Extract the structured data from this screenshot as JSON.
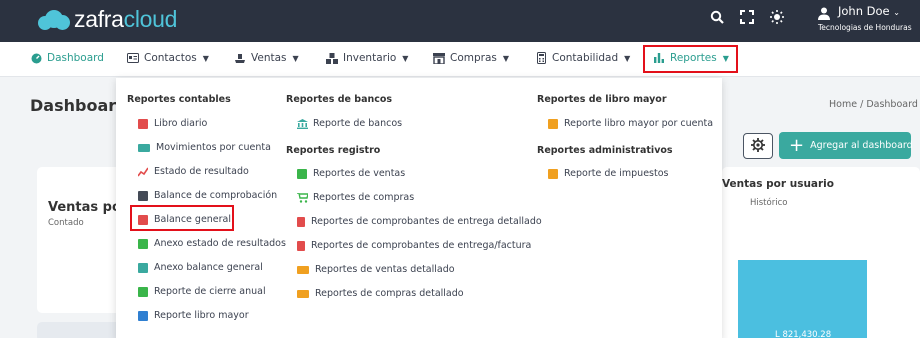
{
  "brand": {
    "name_prefix": "zafra",
    "name_suffix": "cloud"
  },
  "topbar": {
    "icons": [
      "search-icon",
      "fullscreen-icon",
      "brightness-icon"
    ],
    "user_name": "John Doe",
    "organization": "Tecnologias de Honduras"
  },
  "nav": {
    "items": [
      {
        "label": "Dashboard",
        "icon": "dashboard-icon"
      },
      {
        "label": "Contactos",
        "icon": "contact-card-icon"
      },
      {
        "label": "Ventas",
        "icon": "sales-icon"
      },
      {
        "label": "Inventario",
        "icon": "boxes-icon"
      },
      {
        "label": "Compras",
        "icon": "store-icon"
      },
      {
        "label": "Contabilidad",
        "icon": "calculator-icon"
      },
      {
        "label": "Reportes",
        "icon": "bar-chart-icon"
      }
    ]
  },
  "page": {
    "title": "Dashboard",
    "breadcrumb": [
      "Home",
      "Dashboard"
    ],
    "gear_icon": "gear-icon",
    "add_button": "Agregar al dashboard"
  },
  "cards": {
    "ventas_title": "Ventas po",
    "ventas_sub": "Contado",
    "usuario_title": "Ventas por usuario",
    "usuario_sub": "Histórico",
    "bar_value": "L 821,430.28"
  },
  "dropdown": {
    "col1": {
      "heading": "Reportes contables",
      "items": [
        {
          "label": "Libro diario",
          "color": "#e24c4c"
        },
        {
          "label": "Movimientos por cuenta",
          "color": "#3aa99f"
        },
        {
          "label": "Estado de resultado",
          "color": "#e24c4c"
        },
        {
          "label": "Balance de comprobación",
          "color": "#444b57"
        },
        {
          "label": "Balance general",
          "color": "#e24c4c"
        },
        {
          "label": "Anexo estado de resultados",
          "color": "#3ab54a"
        },
        {
          "label": "Anexo balance general",
          "color": "#3aa99f"
        },
        {
          "label": "Reporte de cierre anual",
          "color": "#3ab54a"
        },
        {
          "label": "Reporte libro mayor",
          "color": "#2f7fd1"
        }
      ]
    },
    "col2": {
      "heading": "Reportes de bancos",
      "items": [
        {
          "label": "Reporte de bancos",
          "color": "#3aa99f"
        }
      ],
      "heading2": "Reportes registro",
      "items2": [
        {
          "label": "Reportes de ventas",
          "color": "#3ab54a"
        },
        {
          "label": "Reportes de compras",
          "color": "#3ab54a"
        },
        {
          "label": "Reportes de comprobantes de entrega detallado",
          "color": "#e24c4c"
        },
        {
          "label": "Reportes de comprobantes de entrega/factura",
          "color": "#e24c4c"
        },
        {
          "label": "Reportes de ventas detallado",
          "color": "#f0a020"
        },
        {
          "label": "Reportes de compras detallado",
          "color": "#f0a020"
        }
      ]
    },
    "col3": {
      "heading": "Reportes de libro mayor",
      "items": [
        {
          "label": "Reporte libro mayor por cuenta",
          "color": "#f0a020"
        }
      ],
      "heading2": "Reportes administrativos",
      "items2": [
        {
          "label": "Reporte de impuestos",
          "color": "#f0a020"
        }
      ]
    }
  },
  "colors": {
    "topbar": "#2b3240",
    "accent": "#3aa99f",
    "highlight": "#e3101a",
    "brand_cloud": "#4fc4d9"
  }
}
